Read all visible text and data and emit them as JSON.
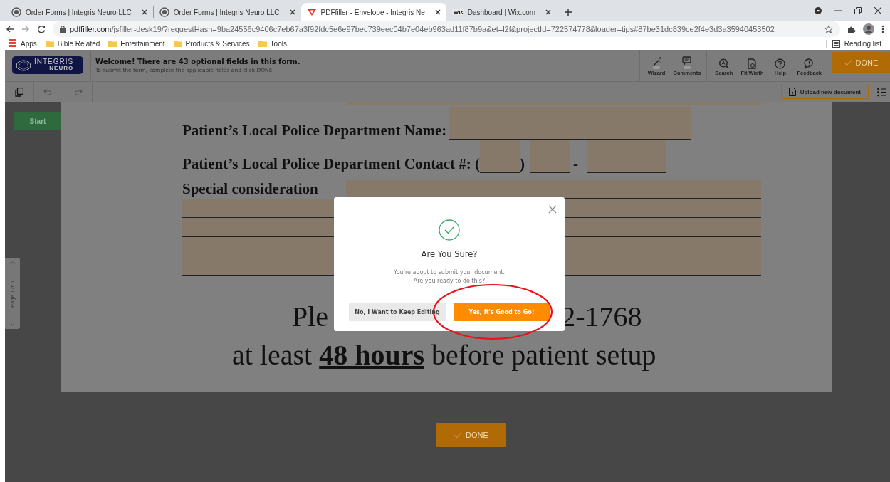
{
  "browser": {
    "tabs": [
      {
        "title": "Order Forms | Integris Neuro LLC",
        "selected": false
      },
      {
        "title": "Order Forms | Integris Neuro LLC",
        "selected": false
      },
      {
        "title": "PDFfiller - Envelope - Integris Ne",
        "selected": true
      },
      {
        "title": "Dashboard | Wix.com",
        "selected": false
      }
    ],
    "url_host": "pdffiller.com",
    "url_path": "/jsfiller-desk19/?requestHash=9ba24556c9406c7eb67a3f92fdc5e6e97bec739eec04b7e04eb963ad11f87b9a&et=l2f&projectId=722574778&loader=tips#87be31dc839ce2f4e3d3a35940453502",
    "bookmarks": [
      {
        "label": "Apps",
        "kind": "apps"
      },
      {
        "label": "Bible Related",
        "kind": "folder"
      },
      {
        "label": "Entertainment",
        "kind": "folder"
      },
      {
        "label": "Products & Services",
        "kind": "folder"
      },
      {
        "label": "Tools",
        "kind": "folder"
      }
    ],
    "reading_list": "Reading list"
  },
  "app": {
    "logo": {
      "name": "INTEGRIS",
      "sub": "NEURO"
    },
    "welcome": {
      "title": "Welcome! There are 43 optional fields in this form.",
      "subtitle": "To submit the form, complete the applicable fields and click DONE."
    },
    "tools": [
      {
        "label": "Wizard",
        "kind": "toggle",
        "on": false
      },
      {
        "label": "Comments",
        "kind": "toggle",
        "on": false
      },
      {
        "label": "Search",
        "kind": "plain"
      },
      {
        "label": "Fit Width",
        "kind": "plain"
      },
      {
        "label": "Help",
        "kind": "plain"
      },
      {
        "label": "Feedback",
        "kind": "plain"
      }
    ],
    "done": "DONE",
    "upload": "Upload new document",
    "start": "Start",
    "page_indicator": "Page 1 of 1"
  },
  "document": {
    "name_label": "Patient’s Local Police Department Name:",
    "contact_label": "Patient’s Local Police Department Contact #: (",
    "contact_close": ")",
    "contact_dash": "-",
    "special_label": "Special consideration",
    "fax_start": "Ple",
    "fax_end": "2-1768",
    "deadline": "at least **48 hours** before patient setup"
  },
  "modal": {
    "title": "Are You Sure?",
    "message": [
      "You're about to submit your document.",
      "Are you ready to do this?"
    ],
    "cancel": "No, I Want to Keep Editing",
    "confirm": "Yes, It's Good to Go!"
  },
  "bottom_done": "DONE"
}
